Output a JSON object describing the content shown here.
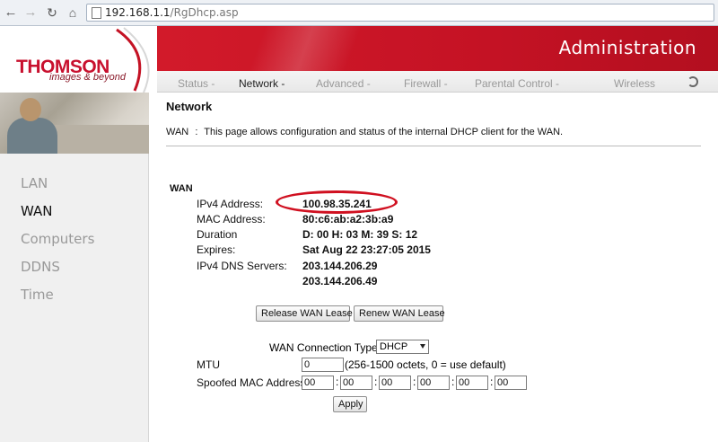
{
  "browser": {
    "url_host": "192.168.1.1",
    "url_path": "/RgDhcp.asp"
  },
  "header": {
    "logo": "THOMSON",
    "tagline": "images & beyond",
    "title": "Administration",
    "tabs": [
      "Status -",
      "Network -",
      "Advanced -",
      "Firewall -",
      "Parental Control -",
      "Wireless"
    ]
  },
  "sidebar": {
    "items": [
      "LAN",
      "WAN",
      "Computers",
      "DDNS",
      "Time"
    ],
    "active": "WAN"
  },
  "page": {
    "title": "Network",
    "desc_key": "WAN",
    "desc_sep": ":",
    "desc_text": "This page allows configuration and status of the internal DHCP client for the WAN.",
    "section": "WAN"
  },
  "status": {
    "ipv4_label": "IPv4 Address:",
    "ipv4_value": "100.98.35.241",
    "mac_label": "MAC Address:",
    "mac_value": "80:c6:ab:a2:3b:a9",
    "duration_label": "Duration",
    "duration_value": "D: 00 H: 03 M: 39 S: 12",
    "expires_label": "Expires:",
    "expires_value": "Sat Aug 22 23:27:05 2015",
    "dns_label": "IPv4 DNS Servers:",
    "dns_values": [
      "203.144.206.29",
      "203.144.206.49"
    ]
  },
  "actions": {
    "release": "Release WAN Lease",
    "renew": "Renew WAN Lease",
    "apply": "Apply"
  },
  "config": {
    "conn_type_label": "WAN Connection Type",
    "conn_type_value": "DHCP",
    "mtu_label": "MTU",
    "mtu_value": "0",
    "mtu_hint": "(256-1500 octets, 0 = use default)",
    "spoof_label": "Spoofed MAC Address",
    "spoof_octets": [
      "00",
      "00",
      "00",
      "00",
      "00",
      "00"
    ]
  },
  "colors": {
    "brand_red": "#c41224",
    "highlight": "#d01020"
  }
}
